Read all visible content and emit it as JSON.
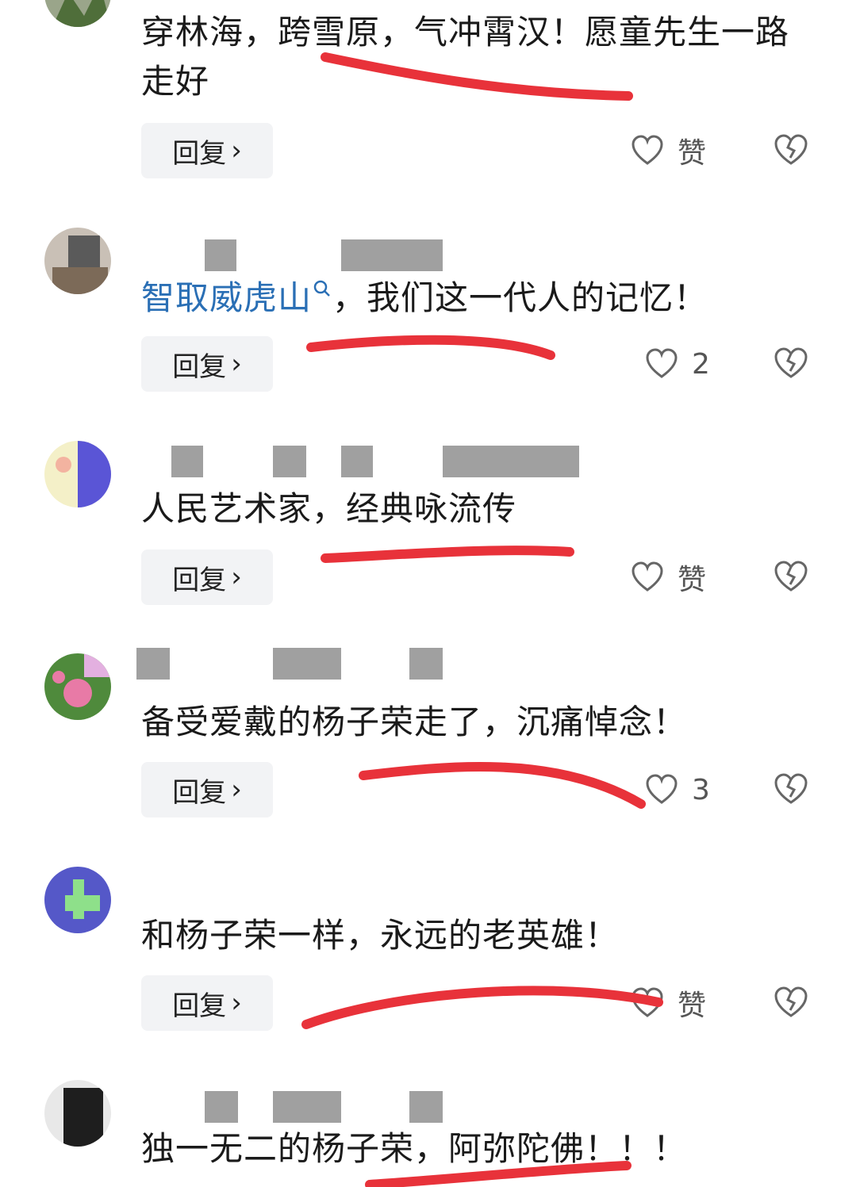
{
  "reply_label": "回复",
  "reply_chevron": "›",
  "like_label": "赞",
  "comments": [
    {
      "text": "穿林海，跨雪原，气冲霄汉！愿童先生一路走好",
      "likes": "赞"
    },
    {
      "link": "智取威虎山",
      "text": "，我们这一代人的记忆！",
      "likes": "2"
    },
    {
      "text": "人民艺术家，经典咏流传",
      "likes": "赞"
    },
    {
      "text": "备受爱戴的杨子荣走了，沉痛悼念！",
      "likes": "3"
    },
    {
      "text": "和杨子荣一样，永远的老英雄！",
      "likes": "赞"
    },
    {
      "text": "独一无二的杨子荣，阿弥陀佛！！！"
    }
  ],
  "icons": {
    "like": "heart-outline-icon",
    "dislike": "broken-heart-icon",
    "search": "search-icon"
  },
  "colors": {
    "link": "#2a6fb5",
    "annotation": "#e8323a",
    "button_bg": "#f2f3f5"
  }
}
